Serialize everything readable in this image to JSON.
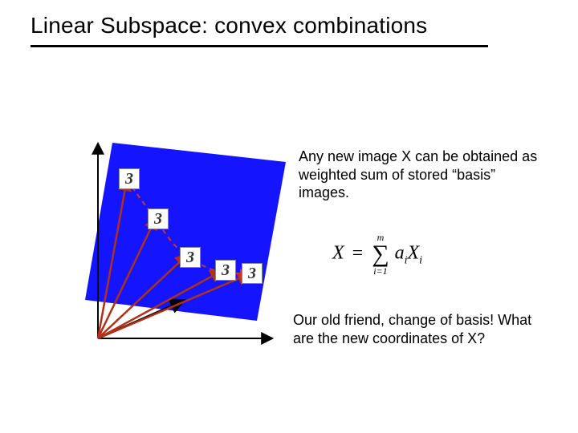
{
  "title": "Linear Subspace: convex combinations",
  "para1": "Any new image X can be obtained as weighted sum of stored “basis” images.",
  "para2": "Our old friend, change of basis! What are the new coordinates of X?",
  "formula": {
    "lhs": "X",
    "eq": "=",
    "sum_top": "m",
    "sum_bottom": "i=1",
    "term_a": "a",
    "term_a_sub": "i",
    "term_x": "X",
    "term_x_sub": "i"
  },
  "thumbs": {
    "glyph": "3"
  },
  "colors": {
    "plane": "#1414ff",
    "vector": "#b03018",
    "dashed": "#c9362a",
    "axis": "#000000"
  }
}
